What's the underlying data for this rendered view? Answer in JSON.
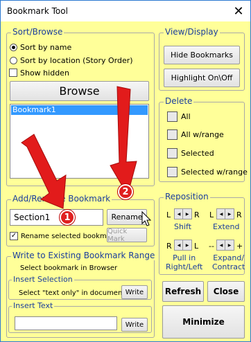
{
  "window": {
    "title": "Bookmark Tool",
    "close_glyph": "✕"
  },
  "sort_browse": {
    "legend": "Sort/Browse",
    "sort_by_name": "Sort by name",
    "sort_by_location": "Sort by location (Story Order)",
    "show_hidden": "Show hidden",
    "browse_button": "Browse",
    "bookmarks": [
      "Bookmark1"
    ],
    "selected_index": 0
  },
  "view_display": {
    "legend": "View/Display",
    "hide_bookmarks": "Hide Bookmarks",
    "highlight_toggle": "Highlight On\\Off"
  },
  "delete": {
    "legend": "Delete",
    "all": "All",
    "all_w_range": "All w/range",
    "selected": "Selected",
    "selected_w_range": "Selected w/range"
  },
  "add_rename": {
    "legend": "Add/Rename Bookmark",
    "name_value": "Section1",
    "rename_button": "Rename",
    "rename_selected": "Rename selected bookmark",
    "rename_checked": true,
    "quick_mark": "Quick Mark"
  },
  "reposition": {
    "legend": "Reposition",
    "shift": "Shift",
    "extend": "Extend",
    "pull_in": "Pull in\nRight/Left",
    "expand_contract": "Expand/\nContract",
    "l": "L",
    "r": "R",
    "dashes": "--",
    "plus": "+"
  },
  "write_existing": {
    "legend": "Write to Existing Bookmark Range",
    "instruction": "Select bookmark in Browser",
    "insert_selection_legend": "Insert Selection",
    "insert_selection_note": "Select \"text only\" in document",
    "write_button_1": "Write",
    "insert_text_legend": "Insert Text",
    "insert_text_value": "",
    "write_button_2": "Write"
  },
  "actions": {
    "refresh": "Refresh",
    "close": "Close",
    "minimize": "Minimize"
  },
  "annotations": {
    "badge_1": "1",
    "badge_2": "2"
  },
  "colors": {
    "panel_bg": "#ffff99",
    "legend_text": "#1a3d9c",
    "selection": "#3399ff",
    "arrow": "#e21b1b"
  },
  "icons": [
    "close-icon",
    "arrow-pointer-icon",
    "spin-left-right-icon"
  ]
}
